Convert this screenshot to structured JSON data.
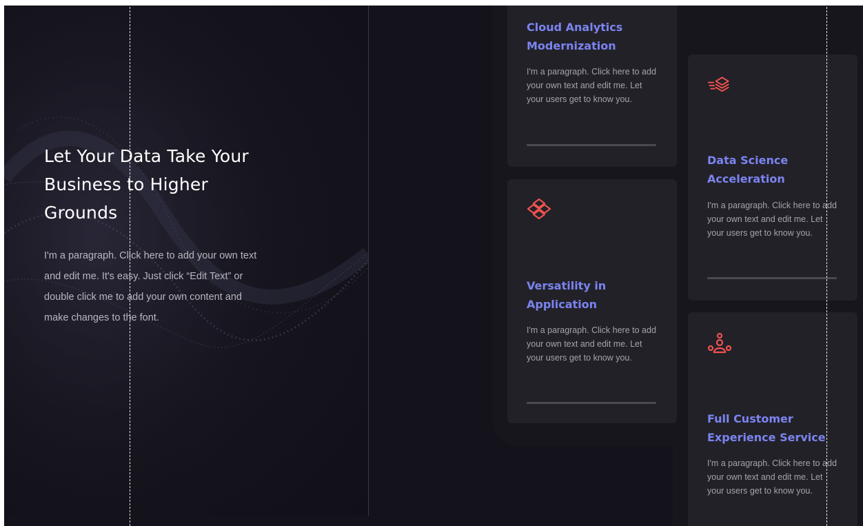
{
  "hero": {
    "title": "Let Your Data Take Your Business to Higher Grounds",
    "paragraph": "I'm a paragraph. Click here to add your own text and edit me. It's easy. Just click “Edit Text” or double click me to add your own content and make changes to the font."
  },
  "cards": [
    {
      "title": "Cloud Analytics Modernization",
      "text": "I'm a paragraph. Click here to add your own text and edit me. Let your users get to know you.",
      "icon": "none"
    },
    {
      "title": "Versatility in Application",
      "text": "I'm a paragraph. Click here to add your own text and edit me. Let your users get to know you.",
      "icon": "layers-diamond-icon"
    },
    {
      "title": "Data Science Acceleration",
      "text": "I'm a paragraph. Click here to add your own text and edit me. Let your users get to know you.",
      "icon": "stacked-layers-speed-icon"
    },
    {
      "title": "Full Customer Experience Service",
      "text": "I'm a paragraph. Click here to add your own text and edit me. Let your users get to know you.",
      "icon": "people-network-icon"
    }
  ],
  "colors": {
    "accent": "#7b84f0",
    "icon": "#f0524f",
    "background": "#14121a",
    "card": "#222128"
  }
}
